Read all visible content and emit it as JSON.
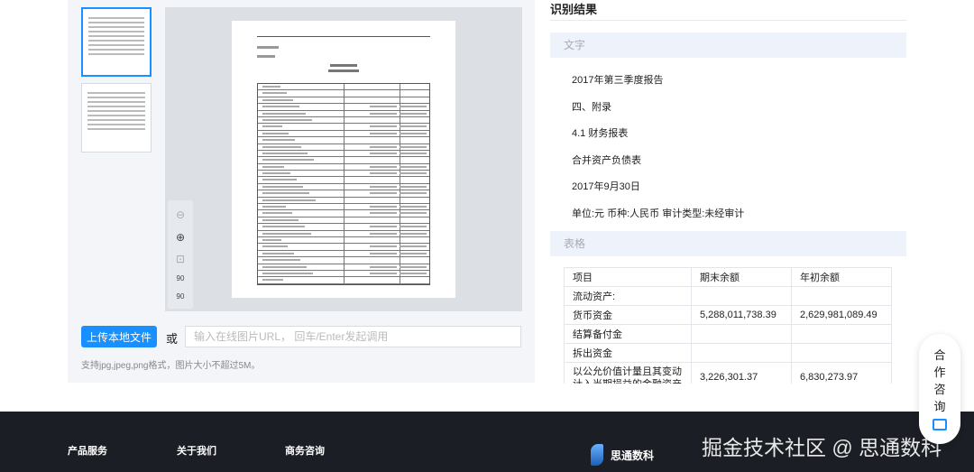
{
  "preview": {
    "tools": [
      "zoom-out",
      "zoom-in",
      "actual-size",
      "rotate-left-90",
      "rotate-right-90"
    ],
    "rotate_label": "90"
  },
  "upload": {
    "button_label": "上传本地文件",
    "or_label": "或",
    "url_placeholder": "输入在线图片URL， 回车/Enter发起调用",
    "hint": "支持jpg,jpeg,png格式，图片大小不超过5M。"
  },
  "result": {
    "title": "识别结果",
    "text_section": "文字",
    "lines": [
      "2017年第三季度报告",
      "四、附录",
      "4.1 财务报表",
      "合并资产负债表",
      "2017年9月30日",
      "单位:元 币种:人民币 审计类型:未经审计"
    ],
    "table_section": "表格",
    "table": {
      "headers": [
        "项目",
        "期末余额",
        "年初余额"
      ],
      "rows": [
        [
          "流动资产:",
          "",
          ""
        ],
        [
          "货币资金",
          "5,288,011,738.39",
          "2,629,981,089.49"
        ],
        [
          "结算备付金",
          "",
          ""
        ],
        [
          "拆出资金",
          "",
          ""
        ],
        [
          "以公允价值计量且其变动计入当期损益的金融资产",
          "3,226,301.37",
          "6,830,273.97"
        ]
      ]
    }
  },
  "footer": {
    "cols": [
      "产品服务",
      "关于我们",
      "商务咨询"
    ],
    "logo": "思通数科",
    "watermark": "掘金技术社区 @ 思通数科"
  },
  "consult": {
    "chars": [
      "合",
      "作",
      "咨",
      "询"
    ]
  },
  "colors": {
    "accent": "#1890ff",
    "footer_bg": "#1b1e24"
  }
}
